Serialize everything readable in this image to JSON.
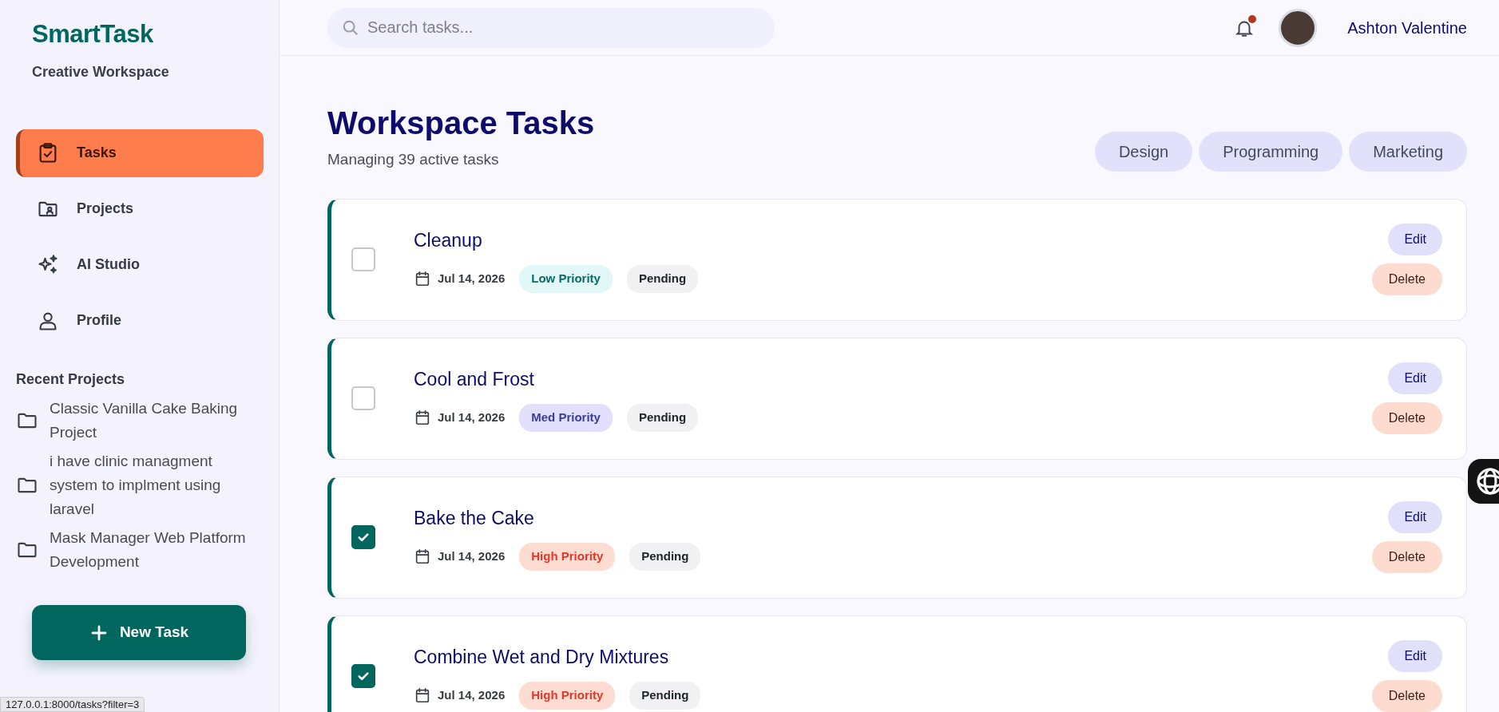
{
  "sidebar": {
    "brand": "SmartTask",
    "subtitle": "Creative Workspace",
    "nav": [
      {
        "label": "Tasks",
        "selected": true
      },
      {
        "label": "Projects",
        "selected": false
      },
      {
        "label": "AI Studio",
        "selected": false
      },
      {
        "label": "Profile",
        "selected": false
      }
    ],
    "recent_title": "Recent Projects",
    "recent_projects": [
      "Classic Vanilla Cake Baking Project",
      "i have clinic managment system to implment using laravel",
      "Mask Manager Web Platform Development"
    ],
    "new_task_button": "New Task"
  },
  "header": {
    "search": {
      "placeholder": "Search tasks..."
    },
    "notifications": {
      "unread": true
    },
    "user_name": "Ashton Valentine"
  },
  "main": {
    "title": "Workspace Tasks",
    "subtitle": "Managing 39 active tasks",
    "filters": [
      "Design",
      "Programming",
      "Marketing"
    ],
    "tasks": [
      {
        "title": "Cleanup",
        "checked": false,
        "date": "Jul 14, 2026",
        "priority": {
          "kind": "low",
          "label": "Low Priority"
        },
        "status": "Pending",
        "edit": "Edit",
        "delete": "Delete"
      },
      {
        "title": "Cool and Frost",
        "checked": false,
        "date": "Jul 14, 2026",
        "priority": {
          "kind": "med",
          "label": "Med Priority"
        },
        "status": "Pending",
        "edit": "Edit",
        "delete": "Delete"
      },
      {
        "title": "Bake the Cake",
        "checked": true,
        "date": "Jul 14, 2026",
        "priority": {
          "kind": "high",
          "label": "High Priority"
        },
        "status": "Pending",
        "edit": "Edit",
        "delete": "Delete"
      },
      {
        "title": "Combine Wet and Dry Mixtures",
        "checked": true,
        "date": "Jul 14, 2026",
        "priority": {
          "kind": "high",
          "label": "High Priority"
        },
        "status": "Pending",
        "edit": "Edit",
        "delete": "Delete"
      }
    ]
  },
  "status_url": "127.0.0.1:8000/tasks?filter=3"
}
